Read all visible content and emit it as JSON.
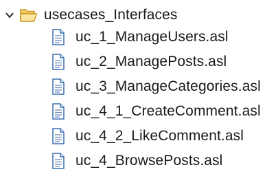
{
  "tree": {
    "folder": {
      "label": "usecases_Interfaces",
      "expanded": true,
      "icon": "folder-open-icon",
      "folder_color": "#e8b83a"
    },
    "files": [
      {
        "label": "uc_1_ManageUsers.asl",
        "icon": "text-file-icon"
      },
      {
        "label": "uc_2_ManagePosts.asl",
        "icon": "text-file-icon"
      },
      {
        "label": "uc_3_ManageCategories.asl",
        "icon": "text-file-icon"
      },
      {
        "label": "uc_4_1_CreateComment.asl",
        "icon": "text-file-icon"
      },
      {
        "label": "uc_4_2_LikeComment.asl",
        "icon": "text-file-icon"
      },
      {
        "label": "uc_4_BrowsePosts.asl",
        "icon": "text-file-icon"
      }
    ]
  }
}
